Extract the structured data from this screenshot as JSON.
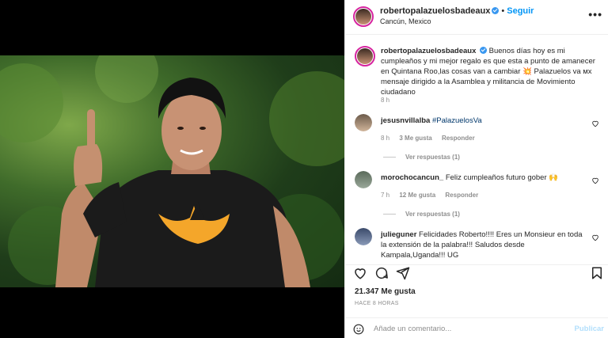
{
  "post": {
    "author": "robertopalazuelosbadeaux",
    "follow_label": "Seguir",
    "location": "Cancún, Mexico",
    "more_label": "•••",
    "caption_user": "robertopalazuelosbadeaux",
    "caption_text": "Buenos días hoy es mi cumpleaños y mi mejor regalo es que esta a punto de amanecer en Quintana Roo,las cosas van a cambiar 💥 Palazuelos va мх mensaje dirigido a la Asamblea y militancia de Movimiento ciudadano",
    "caption_time": "8 h"
  },
  "comments": [
    {
      "user": "jesusnvillalba",
      "text": "",
      "tag": "#PalazuelosVa",
      "time": "8 h",
      "likes": "3 Me gusta",
      "reply_label": "Responder",
      "view_replies": "Ver respuestas (1)"
    },
    {
      "user": "morochocancun_",
      "text": "Feliz cumpleaños futuro gober 🙌",
      "tag": "",
      "time": "7 h",
      "likes": "12 Me gusta",
      "reply_label": "Responder",
      "view_replies": "Ver respuestas (1)"
    },
    {
      "user": "julieguner",
      "text": "Felicidades Roberto!!!! Eres un Monsieur en toda la extensión de la palabra!!! Saludos desde Kampala,Uganda!!! UG",
      "tag": ""
    }
  ],
  "footer": {
    "likes": "21.347 Me gusta",
    "time_ago": "HACE 8 HORAS",
    "comment_placeholder": "Añade un comentario...",
    "publish_label": "Publicar"
  },
  "icons": [
    "heart-icon",
    "comment-icon",
    "share-icon",
    "bookmark-icon",
    "emoji-icon",
    "verified-icon"
  ],
  "colors": {
    "accent": "#0095f6",
    "verified": "#3897f0",
    "shirt_logo": "#f4a62a"
  }
}
